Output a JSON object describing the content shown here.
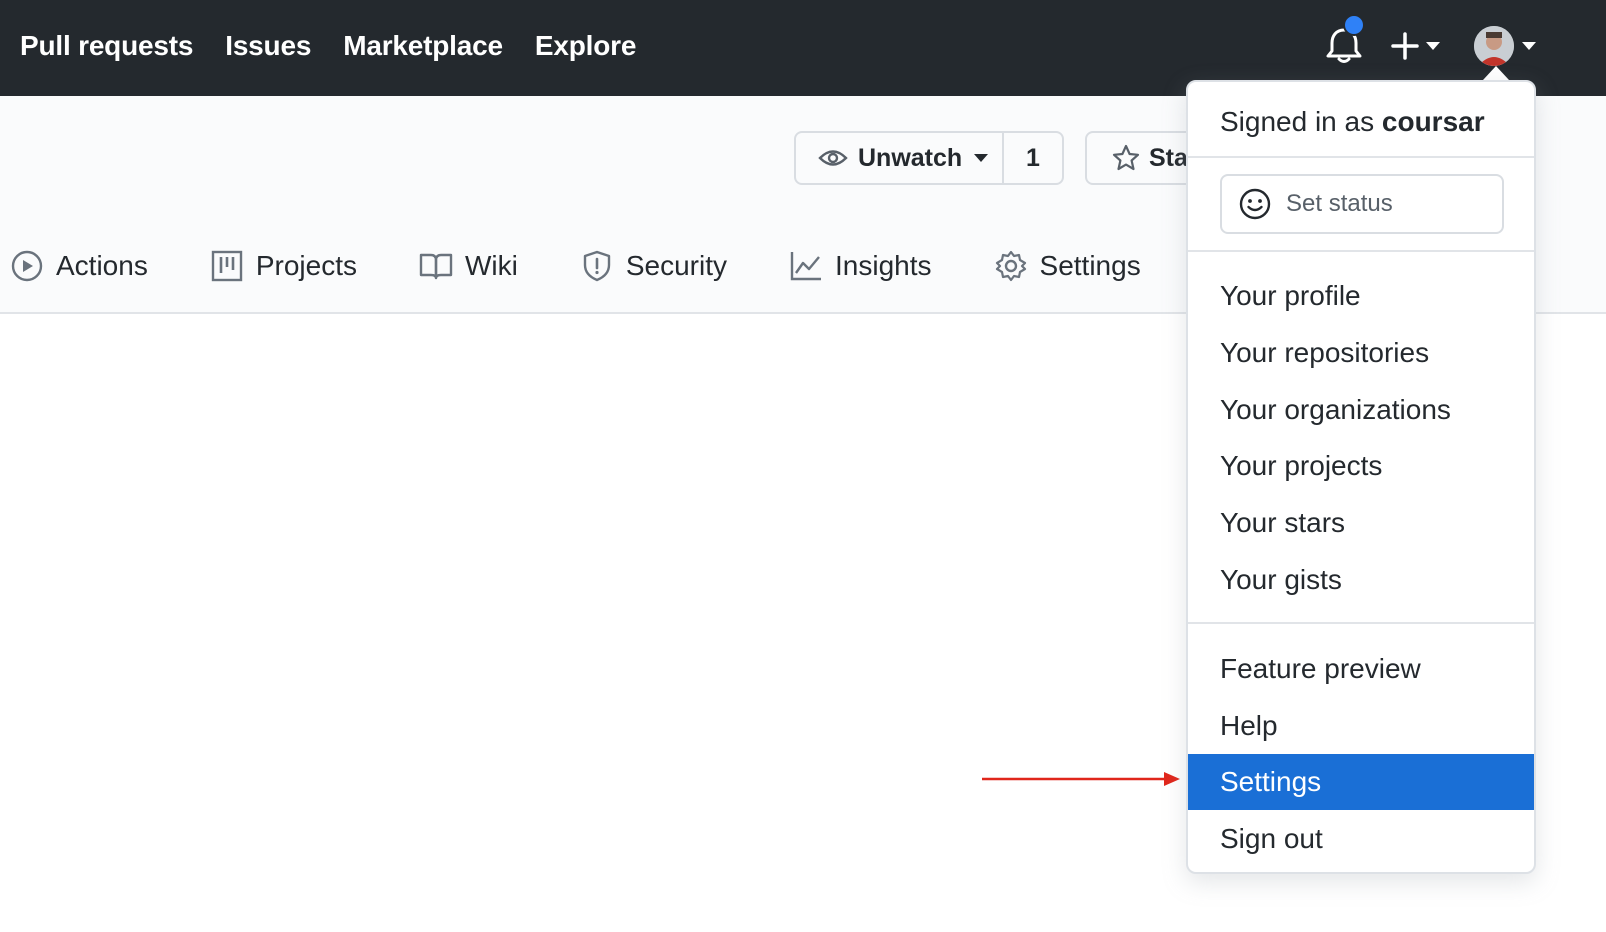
{
  "topnav": {
    "items": [
      "Pull requests",
      "Issues",
      "Marketplace",
      "Explore"
    ]
  },
  "icons": {
    "notifications": "bell-icon",
    "create": "plus-icon",
    "avatar": "user-avatar"
  },
  "repo_actions": {
    "unwatch_label": "Unwatch",
    "watch_count": "1",
    "star_label": "Sta"
  },
  "tabs": [
    {
      "label": "Actions",
      "icon": "play-circle-icon"
    },
    {
      "label": "Projects",
      "icon": "project-board-icon"
    },
    {
      "label": "Wiki",
      "icon": "book-icon"
    },
    {
      "label": "Security",
      "icon": "shield-icon"
    },
    {
      "label": "Insights",
      "icon": "graph-icon"
    },
    {
      "label": "Settings",
      "icon": "gear-icon"
    }
  ],
  "dropdown": {
    "signed_in_prefix": "Signed in as ",
    "username": "coursar",
    "set_status": "Set status",
    "group1": [
      "Your profile",
      "Your repositories",
      "Your organizations",
      "Your projects",
      "Your stars",
      "Your gists"
    ],
    "group2": [
      "Feature preview",
      "Help",
      "Settings",
      "Sign out"
    ],
    "highlighted": "Settings"
  },
  "colors": {
    "header_bg": "#24292e",
    "highlight": "#1a6fd6",
    "notification_dot": "#2f81f7",
    "annotation_arrow": "#e0261b"
  }
}
